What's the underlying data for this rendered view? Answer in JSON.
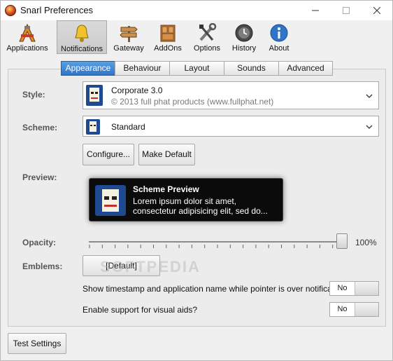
{
  "window": {
    "title": "Snarl Preferences"
  },
  "toolbar": {
    "items": [
      {
        "label": "Applications",
        "icon": "applications-icon"
      },
      {
        "label": "Notifications",
        "icon": "bell-icon",
        "active": true
      },
      {
        "label": "Gateway",
        "icon": "signpost-icon"
      },
      {
        "label": "AddOns",
        "icon": "cabinet-icon"
      },
      {
        "label": "Options",
        "icon": "tools-icon"
      },
      {
        "label": "History",
        "icon": "history-icon"
      },
      {
        "label": "About",
        "icon": "info-icon"
      }
    ]
  },
  "tabs": [
    "Appearance",
    "Behaviour",
    "Layout",
    "Sounds",
    "Advanced"
  ],
  "style": {
    "label": "Style:",
    "name": "Corporate 3.0",
    "sub": "© 2013 full phat products (www.fullphat.net)"
  },
  "scheme": {
    "label": "Scheme:",
    "value": "Standard"
  },
  "buttons": {
    "configure": "Configure...",
    "make_default": "Make Default",
    "test_settings": "Test Settings"
  },
  "preview": {
    "label": "Preview:",
    "title": "Scheme Preview",
    "text": "Lorem ipsum dolor sit amet, consectetur adipisicing elit, sed do..."
  },
  "opacity": {
    "label": "Opacity:",
    "value_text": "100%",
    "value": 1.0
  },
  "emblems": {
    "label": "Emblems:",
    "value": "[Default]"
  },
  "options": [
    {
      "text": "Show timestamp and application name while pointer is over notification?",
      "value": "No"
    },
    {
      "text": "Enable support for visual aids?",
      "value": "No"
    }
  ],
  "watermark": "SOFTPEDIA",
  "colors": {
    "accent": "#2f74c9",
    "preview_bg": "#0b0b0b",
    "icon_blue": "#1f4a92"
  }
}
